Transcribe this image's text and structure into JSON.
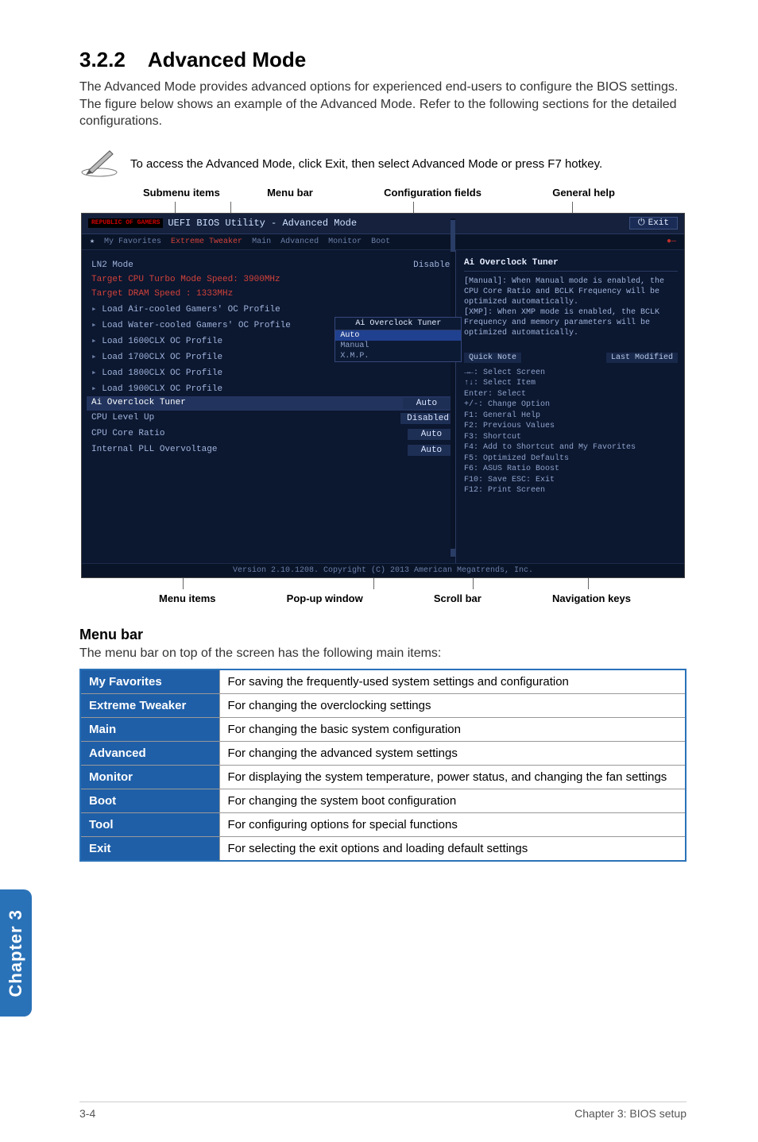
{
  "heading_num": "3.2.2",
  "heading_title": "Advanced Mode",
  "intro": "The Advanced Mode provides advanced options for experienced end-users to configure the BIOS settings. The figure below shows an example of the Advanced Mode. Refer to the following sections for the detailed configurations.",
  "note": "To access the Advanced Mode, click Exit, then select Advanced Mode or press F7 hotkey.",
  "top_labels": {
    "a": "Submenu items",
    "b": "Menu bar",
    "c": "Configuration fields",
    "d": "General help"
  },
  "bottom_labels": {
    "a": "Menu items",
    "b": "Pop-up window",
    "c": "Scroll bar",
    "d": "Navigation keys"
  },
  "bios": {
    "brand": "REPUBLIC OF GAMERS",
    "title": "UEFI BIOS Utility - Advanced Mode",
    "exit": "Exit",
    "menubar": {
      "star": "★",
      "fav": "My Favorites",
      "tweaker": "Extreme Tweaker",
      "main": "Main",
      "advanced": "Advanced",
      "monitor": "Monitor",
      "boot": "Boot"
    },
    "left": {
      "l1": "LN2 Mode",
      "l1v": "Disabled",
      "l2": "Target CPU Turbo Mode Speed: 3900MHz",
      "l3": "Target DRAM Speed : 1333MHz",
      "l4": "Load Air-cooled Gamers'  OC Profile",
      "l5": "Load Water-cooled Gamers'  OC Profile",
      "l6": "Load 1600CLX OC Profile",
      "l7": "Load 1700CLX OC Profile",
      "l8": "Load 1800CLX OC Profile",
      "l9": "Load 1900CLX OC Profile",
      "sec": "Ai Overclock Tuner",
      "r1l": "CPU Level Up",
      "r1v": "Disabled",
      "r2l": "CPU Core Ratio",
      "r2v": "Auto",
      "r3l": "Internal PLL Overvoltage",
      "r3v": "Auto",
      "selv": "Auto"
    },
    "popup": {
      "title": "Ai Overclock Tuner",
      "o1": "Auto",
      "o2": "Manual",
      "o3": "X.M.P."
    },
    "right": {
      "title": "Ai Overclock Tuner",
      "desc": "[Manual]: When Manual mode is enabled, the CPU Core Ratio and BCLK Frequency will be optimized automatically.\n[XMP]: When XMP mode is enabled, the BCLK Frequency and memory parameters will be optimized automatically.",
      "qnote": "Quick Note",
      "lastmod": "Last Modified",
      "nav": "→←: Select Screen\n↑↓: Select Item\nEnter: Select\n+/-: Change Option\nF1: General Help\nF2: Previous Values\nF3: Shortcut\nF4: Add to Shortcut and My Favorites\nF5: Optimized Defaults\nF6: ASUS Ratio Boost\nF10: Save  ESC: Exit\nF12: Print Screen"
    },
    "footer": "Version 2.10.1208. Copyright (C) 2013 American Megatrends, Inc."
  },
  "menubar_section": {
    "title": "Menu bar",
    "desc": "The menu bar on top of the screen has the following main items:"
  },
  "table": [
    {
      "k": "My Favorites",
      "v": "For saving the frequently-used system settings and configuration"
    },
    {
      "k": "Extreme Tweaker",
      "v": "For changing the overclocking settings"
    },
    {
      "k": "Main",
      "v": "For changing the basic system configuration"
    },
    {
      "k": "Advanced",
      "v": "For changing the advanced system settings"
    },
    {
      "k": "Monitor",
      "v": "For displaying the system temperature, power status, and changing the fan settings"
    },
    {
      "k": "Boot",
      "v": "For changing the system boot configuration"
    },
    {
      "k": "Tool",
      "v": "For configuring options for special functions"
    },
    {
      "k": "Exit",
      "v": "For selecting the exit options and loading default settings"
    }
  ],
  "side_tab": "Chapter 3",
  "footer_left": "3-4",
  "footer_right": "Chapter 3: BIOS setup"
}
